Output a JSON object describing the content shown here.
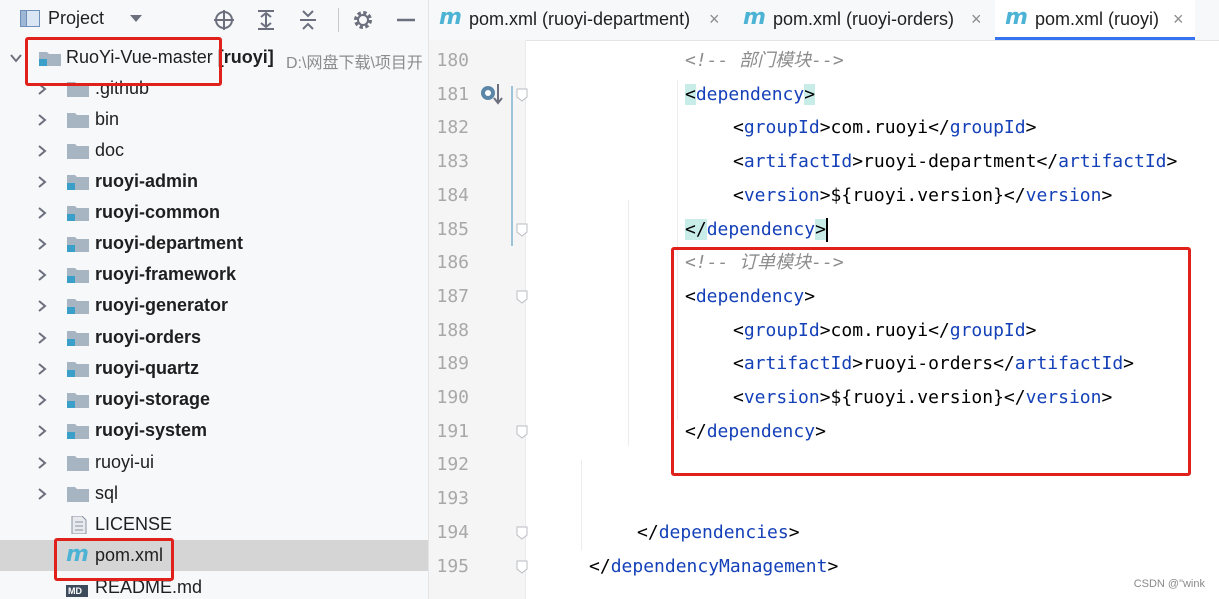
{
  "project_panel": {
    "title": "Project",
    "tree": [
      {
        "label": "RuoYi-Vue-master",
        "tag": "[ruoyi]",
        "path": "D:\\网盘下载\\项目开"
      },
      {
        "label": ".github"
      },
      {
        "label": "bin"
      },
      {
        "label": "doc"
      },
      {
        "label": "ruoyi-admin"
      },
      {
        "label": "ruoyi-common"
      },
      {
        "label": "ruoyi-department"
      },
      {
        "label": "ruoyi-framework"
      },
      {
        "label": "ruoyi-generator"
      },
      {
        "label": "ruoyi-orders"
      },
      {
        "label": "ruoyi-quartz"
      },
      {
        "label": "ruoyi-storage"
      },
      {
        "label": "ruoyi-system"
      },
      {
        "label": "ruoyi-ui"
      },
      {
        "label": "sql"
      },
      {
        "label": "LICENSE"
      },
      {
        "label": "pom.xml"
      },
      {
        "label": "README.md",
        "icon_text": "MD"
      }
    ]
  },
  "tabs": [
    {
      "label": "pom.xml (ruoyi-department)",
      "close": "×"
    },
    {
      "label": "pom.xml (ruoyi-orders)",
      "close": "×"
    },
    {
      "label": "pom.xml (ruoyi)",
      "close": "×"
    }
  ],
  "tab_icon": "m",
  "editor": {
    "lines": [
      {
        "num": "180",
        "parts": [
          {
            "t": "<!-- 部门模块-->",
            "c": "comment"
          }
        ]
      },
      {
        "num": "181",
        "parts": [
          {
            "t": "<",
            "c": "bracket"
          },
          {
            "t": "dependency",
            "c": "tag"
          },
          {
            "t": ">",
            "c": "bracket"
          }
        ]
      },
      {
        "num": "182",
        "parts": [
          {
            "t": "<",
            "c": "plain"
          },
          {
            "t": "groupId",
            "c": "tag"
          },
          {
            "t": ">com.ruoyi</",
            "c": "plain"
          },
          {
            "t": "groupId",
            "c": "tag"
          },
          {
            "t": ">",
            "c": "plain"
          }
        ]
      },
      {
        "num": "183",
        "parts": [
          {
            "t": "<",
            "c": "plain"
          },
          {
            "t": "artifactId",
            "c": "tag"
          },
          {
            "t": ">ruoyi-department</",
            "c": "plain"
          },
          {
            "t": "artifactId",
            "c": "tag"
          },
          {
            "t": ">",
            "c": "plain"
          }
        ]
      },
      {
        "num": "184",
        "parts": [
          {
            "t": "<",
            "c": "plain"
          },
          {
            "t": "version",
            "c": "tag"
          },
          {
            "t": ">${ruoyi.version}</",
            "c": "plain"
          },
          {
            "t": "version",
            "c": "tag"
          },
          {
            "t": ">",
            "c": "plain"
          }
        ]
      },
      {
        "num": "185",
        "parts": [
          {
            "t": "</",
            "c": "bracket"
          },
          {
            "t": "dependency",
            "c": "tag"
          },
          {
            "t": ">",
            "c": "bracket"
          }
        ]
      },
      {
        "num": "186",
        "parts": [
          {
            "t": "<!-- 订单模块-->",
            "c": "comment"
          }
        ]
      },
      {
        "num": "187",
        "parts": [
          {
            "t": "<",
            "c": "plain"
          },
          {
            "t": "dependency",
            "c": "tag"
          },
          {
            "t": ">",
            "c": "plain"
          }
        ]
      },
      {
        "num": "188",
        "parts": [
          {
            "t": "<",
            "c": "plain"
          },
          {
            "t": "groupId",
            "c": "tag"
          },
          {
            "t": ">com.ruoyi</",
            "c": "plain"
          },
          {
            "t": "groupId",
            "c": "tag"
          },
          {
            "t": ">",
            "c": "plain"
          }
        ]
      },
      {
        "num": "189",
        "parts": [
          {
            "t": "<",
            "c": "plain"
          },
          {
            "t": "artifactId",
            "c": "tag"
          },
          {
            "t": ">ruoyi-orders</",
            "c": "plain"
          },
          {
            "t": "artifactId",
            "c": "tag"
          },
          {
            "t": ">",
            "c": "plain"
          }
        ]
      },
      {
        "num": "190",
        "parts": [
          {
            "t": "<",
            "c": "plain"
          },
          {
            "t": "version",
            "c": "tag"
          },
          {
            "t": ">${ruoyi.version}</",
            "c": "plain"
          },
          {
            "t": "version",
            "c": "tag"
          },
          {
            "t": ">",
            "c": "plain"
          }
        ]
      },
      {
        "num": "191",
        "parts": [
          {
            "t": "</",
            "c": "plain"
          },
          {
            "t": "dependency",
            "c": "tag"
          },
          {
            "t": ">",
            "c": "plain"
          }
        ]
      },
      {
        "num": "192",
        "parts": []
      },
      {
        "num": "193",
        "parts": []
      },
      {
        "num": "194",
        "parts": [
          {
            "t": "</",
            "c": "plain"
          },
          {
            "t": "dependencies",
            "c": "tag"
          },
          {
            "t": ">",
            "c": "plain"
          }
        ]
      },
      {
        "num": "195",
        "parts": [
          {
            "t": "</",
            "c": "plain"
          },
          {
            "t": "dependencyManagement",
            "c": "tag"
          },
          {
            "t": ">",
            "c": "plain"
          }
        ]
      }
    ]
  },
  "watermark": "CSDN @\"wink",
  "colors": {
    "annotation": "#e0201a",
    "tag": "#1440b8",
    "comment": "#8c8c8c",
    "accent": "#3574f0"
  }
}
